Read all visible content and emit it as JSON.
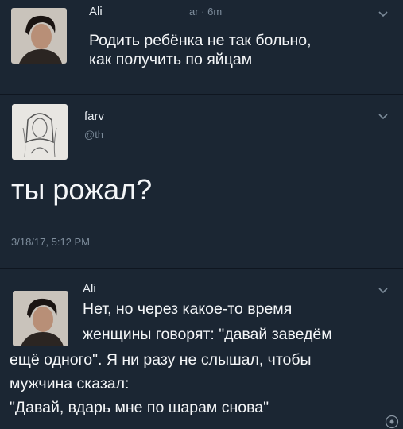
{
  "tweet1": {
    "name": "Ali",
    "meta": "ar · 6m",
    "text_line1": "Родить ребёнка не так больно,",
    "text_line2": "как получить по яйцам",
    "avatar_icon": "user-avatar-icon",
    "chevron_icon": "chevron-down-icon"
  },
  "tweet2": {
    "name": "farv",
    "handle": "@th",
    "text": "ты рожал?",
    "timestamp": "3/18/17, 5:12 PM",
    "avatar_icon": "user-avatar-icon",
    "chevron_icon": "chevron-down-icon"
  },
  "tweet3": {
    "name": "Ali",
    "lines_indented": [
      "Нет, но через какое-то время",
      "женщины говорят: \"давай заведём"
    ],
    "lines_full": [
      "ещё одного\". Я ни разу не слышал, чтобы",
      "мужчина сказал:",
      "\"Давай, вдарь мне по шарам снова\""
    ],
    "avatar_icon": "user-avatar-icon",
    "chevron_icon": "chevron-down-icon"
  },
  "colors": {
    "background": "#1b2633",
    "text": "#f4f6f8",
    "muted": "#7d8c9b"
  }
}
